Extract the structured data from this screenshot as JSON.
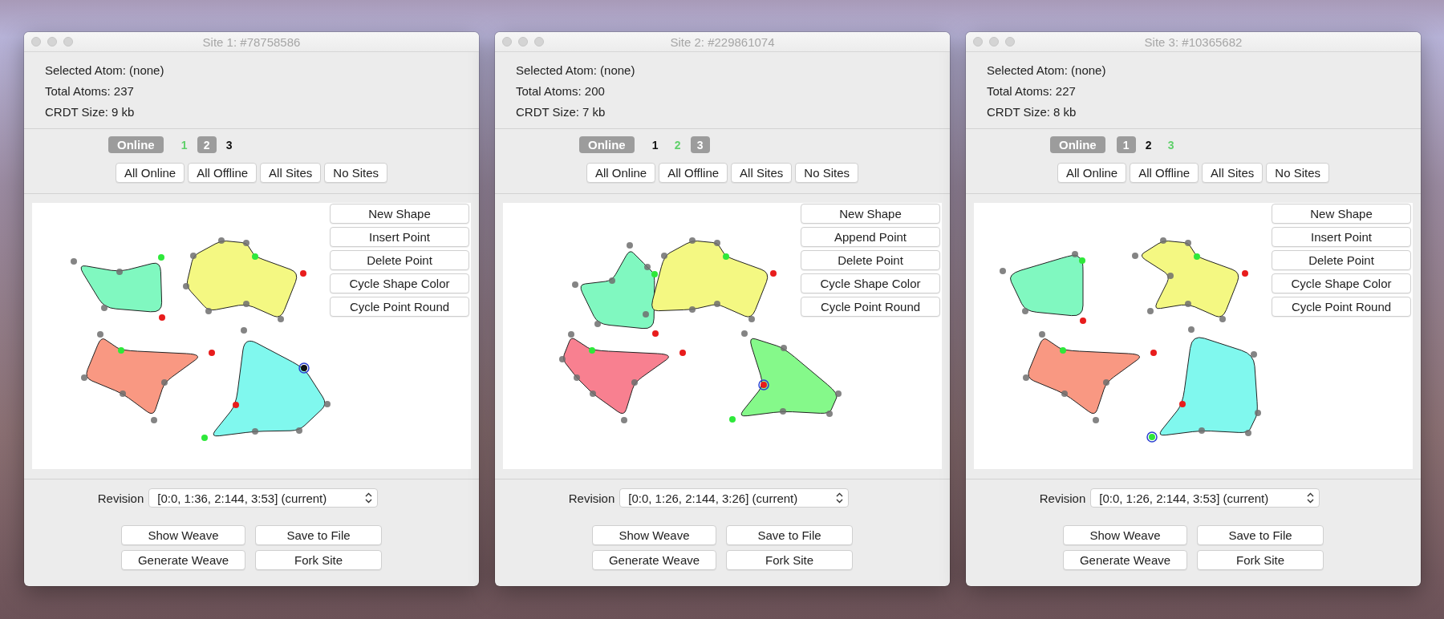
{
  "windows": [
    {
      "title": "Site 1: #78758586",
      "info": [
        "Selected Atom: (none)",
        "Total Atoms: 237",
        "CRDT Size: 9 kb"
      ],
      "online": {
        "label": "Online",
        "on": true
      },
      "sites": [
        {
          "label": "1",
          "kind": "self"
        },
        {
          "label": "2",
          "kind": "connected"
        },
        {
          "label": "3",
          "kind": "disconnected"
        }
      ],
      "site_buttons": [
        "All Online",
        "All Offline",
        "All Sites",
        "No Sites"
      ],
      "shapes": [
        {
          "color": "#80f8c0",
          "selected": false
        },
        {
          "color": "#f4f882",
          "selected": false
        },
        {
          "color": "#f99882",
          "selected": false
        },
        {
          "color": "#80f8ee",
          "selected": true
        }
      ],
      "tool_buttons": [
        "New Shape",
        "Insert Point",
        "Delete Point",
        "Cycle Shape Color",
        "Cycle Point Round"
      ],
      "revision": {
        "label": "Revision",
        "value": "[0:0, 1:36, 2:144, 3:53] (current)"
      },
      "action_buttons": [
        "Show Weave",
        "Save to File",
        "Generate Weave",
        "Fork Site"
      ]
    },
    {
      "title": "Site 2: #229861074",
      "info": [
        "Selected Atom: (none)",
        "Total Atoms: 200",
        "CRDT Size: 7 kb"
      ],
      "online": {
        "label": "Online",
        "on": true
      },
      "sites": [
        {
          "label": "1",
          "kind": "disconnected"
        },
        {
          "label": "2",
          "kind": "self"
        },
        {
          "label": "3",
          "kind": "connected"
        }
      ],
      "site_buttons": [
        "All Online",
        "All Offline",
        "All Sites",
        "No Sites"
      ],
      "shapes": [
        {
          "color": "#80f8c0",
          "selected": false
        },
        {
          "color": "#f4f882",
          "selected": false
        },
        {
          "color": "#f88090",
          "selected": false
        },
        {
          "color": "#85f98a",
          "selected": true
        }
      ],
      "tool_buttons": [
        "New Shape",
        "Append Point",
        "Delete Point",
        "Cycle Shape Color",
        "Cycle Point Round"
      ],
      "revision": {
        "label": "Revision",
        "value": "[0:0, 1:26, 2:144, 3:26] (current)"
      },
      "action_buttons": [
        "Show Weave",
        "Save to File",
        "Generate Weave",
        "Fork Site"
      ]
    },
    {
      "title": "Site 3: #10365682",
      "info": [
        "Selected Atom: (none)",
        "Total Atoms: 227",
        "CRDT Size: 8 kb"
      ],
      "online": {
        "label": "Online",
        "on": true
      },
      "sites": [
        {
          "label": "1",
          "kind": "connected"
        },
        {
          "label": "2",
          "kind": "disconnected"
        },
        {
          "label": "3",
          "kind": "self"
        }
      ],
      "site_buttons": [
        "All Online",
        "All Offline",
        "All Sites",
        "No Sites"
      ],
      "shapes": [
        {
          "color": "#80f8c0",
          "selected": false
        },
        {
          "color": "#f4f882",
          "selected": false
        },
        {
          "color": "#f99882",
          "selected": false
        },
        {
          "color": "#80f8ee",
          "selected": true
        }
      ],
      "tool_buttons": [
        "New Shape",
        "Insert Point",
        "Delete Point",
        "Cycle Shape Color",
        "Cycle Point Round"
      ],
      "revision": {
        "label": "Revision",
        "value": "[0:0, 1:26, 2:144, 3:53] (current)"
      },
      "action_buttons": [
        "Show Weave",
        "Save to File",
        "Generate Weave",
        "Fork Site"
      ]
    }
  ]
}
